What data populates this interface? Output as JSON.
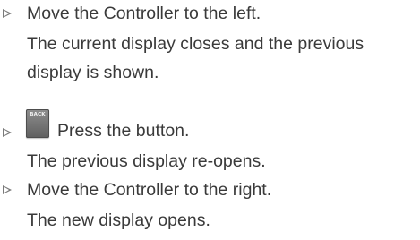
{
  "steps": [
    {
      "instruction": "Move the Controller to the left.",
      "result": "The current display closes and the previous display is shown."
    },
    {
      "button_label": "BACK",
      "button_icon": "back-button-icon",
      "instruction": "Press the button.",
      "result": "The previous display re-opens."
    },
    {
      "instruction": "Move the Controller to the right.",
      "result": "The new display opens."
    }
  ],
  "colors": {
    "text": "#3a3a3a",
    "bullet": "#7a7a7a",
    "button": "#707070"
  }
}
